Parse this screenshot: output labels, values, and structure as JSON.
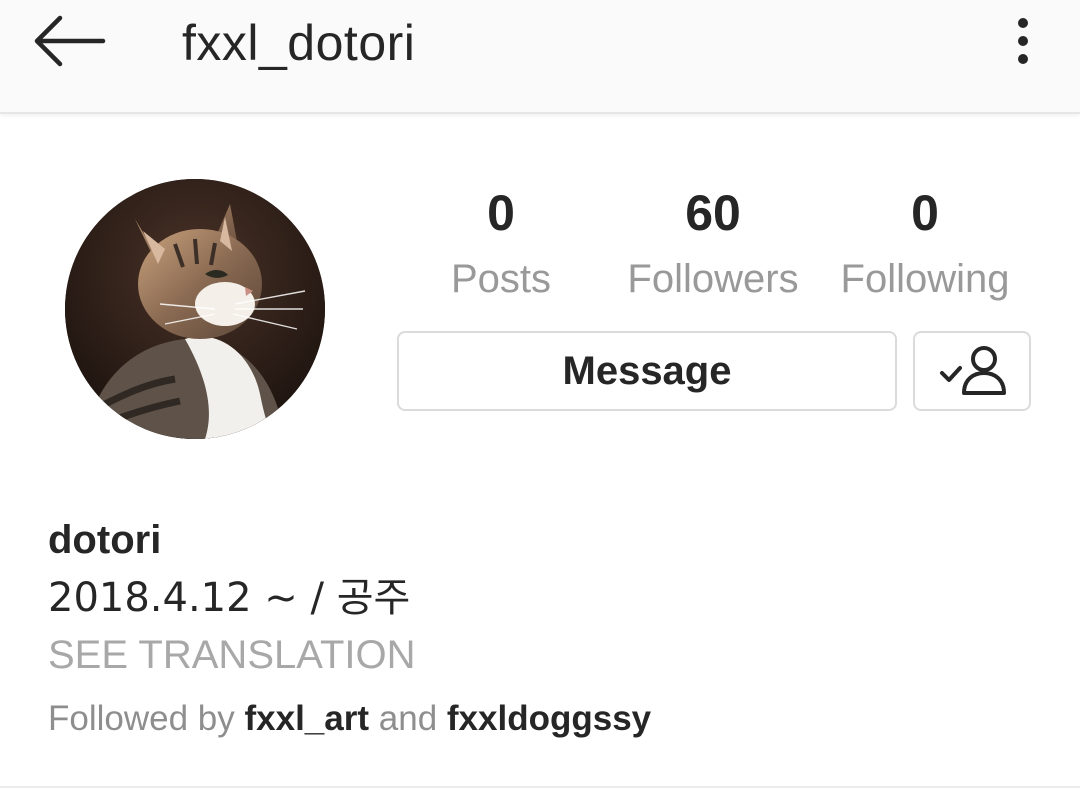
{
  "header": {
    "username": "fxxl_dotori",
    "back_icon": "arrow-left-icon",
    "menu_icon": "more-vertical-icon"
  },
  "profile": {
    "avatar_description": "cat-photo",
    "stats": {
      "posts": {
        "value": "0",
        "label": "Posts"
      },
      "followers": {
        "value": "60",
        "label": "Followers"
      },
      "following": {
        "value": "0",
        "label": "Following"
      }
    },
    "buttons": {
      "message_label": "Message",
      "following_icon": "user-check-icon"
    },
    "bio": {
      "name": "dotori",
      "text": "2018.4.12 ~ / 공주",
      "see_translation": "SEE TRANSLATION"
    },
    "followed_by": {
      "prefix": "Followed by",
      "account_1": "fxxl_art",
      "conjunction": "and",
      "account_2": "fxxldoggssy"
    }
  },
  "colors": {
    "text_primary": "#262626",
    "text_secondary": "#999999",
    "border": "#dbdbdb",
    "header_bg": "#fafafa"
  }
}
